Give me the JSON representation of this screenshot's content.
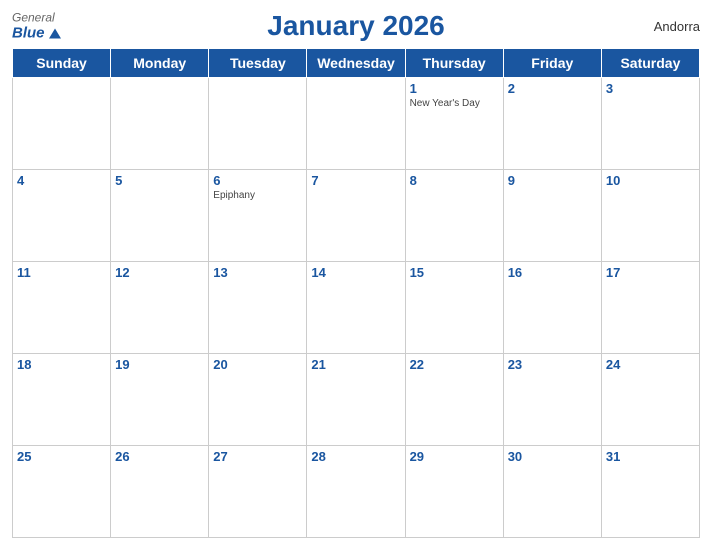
{
  "header": {
    "title": "January 2026",
    "country": "Andorra",
    "logo_general": "General",
    "logo_blue": "Blue"
  },
  "weekdays": [
    "Sunday",
    "Monday",
    "Tuesday",
    "Wednesday",
    "Thursday",
    "Friday",
    "Saturday"
  ],
  "weeks": [
    [
      {
        "day": "",
        "events": []
      },
      {
        "day": "",
        "events": []
      },
      {
        "day": "",
        "events": []
      },
      {
        "day": "",
        "events": []
      },
      {
        "day": "1",
        "events": [
          "New Year's Day"
        ]
      },
      {
        "day": "2",
        "events": []
      },
      {
        "day": "3",
        "events": []
      }
    ],
    [
      {
        "day": "4",
        "events": []
      },
      {
        "day": "5",
        "events": []
      },
      {
        "day": "6",
        "events": [
          "Epiphany"
        ]
      },
      {
        "day": "7",
        "events": []
      },
      {
        "day": "8",
        "events": []
      },
      {
        "day": "9",
        "events": []
      },
      {
        "day": "10",
        "events": []
      }
    ],
    [
      {
        "day": "11",
        "events": []
      },
      {
        "day": "12",
        "events": []
      },
      {
        "day": "13",
        "events": []
      },
      {
        "day": "14",
        "events": []
      },
      {
        "day": "15",
        "events": []
      },
      {
        "day": "16",
        "events": []
      },
      {
        "day": "17",
        "events": []
      }
    ],
    [
      {
        "day": "18",
        "events": []
      },
      {
        "day": "19",
        "events": []
      },
      {
        "day": "20",
        "events": []
      },
      {
        "day": "21",
        "events": []
      },
      {
        "day": "22",
        "events": []
      },
      {
        "day": "23",
        "events": []
      },
      {
        "day": "24",
        "events": []
      }
    ],
    [
      {
        "day": "25",
        "events": []
      },
      {
        "day": "26",
        "events": []
      },
      {
        "day": "27",
        "events": []
      },
      {
        "day": "28",
        "events": []
      },
      {
        "day": "29",
        "events": []
      },
      {
        "day": "30",
        "events": []
      },
      {
        "day": "31",
        "events": []
      }
    ]
  ]
}
